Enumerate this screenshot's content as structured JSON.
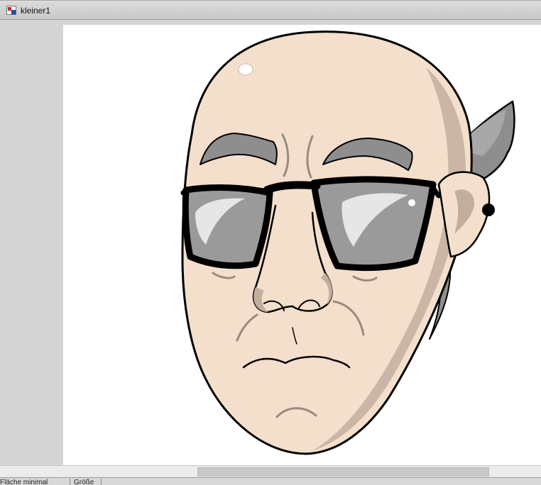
{
  "window": {
    "title": "kleiner1",
    "app_icon": "image-icon"
  },
  "canvas": {
    "image_subject": "cartoon-face-with-sunglasses",
    "colors": {
      "skin": "#f3dfcc",
      "skin_shadow": "#c2ae9f",
      "hair": "#8e8e8e",
      "outline": "#000000",
      "lens": "#9a9a9a",
      "lens_highlight": "#e6e6e6"
    }
  },
  "statusbar": {
    "cell1": "Fläche minimal",
    "cell2": "Größe"
  }
}
